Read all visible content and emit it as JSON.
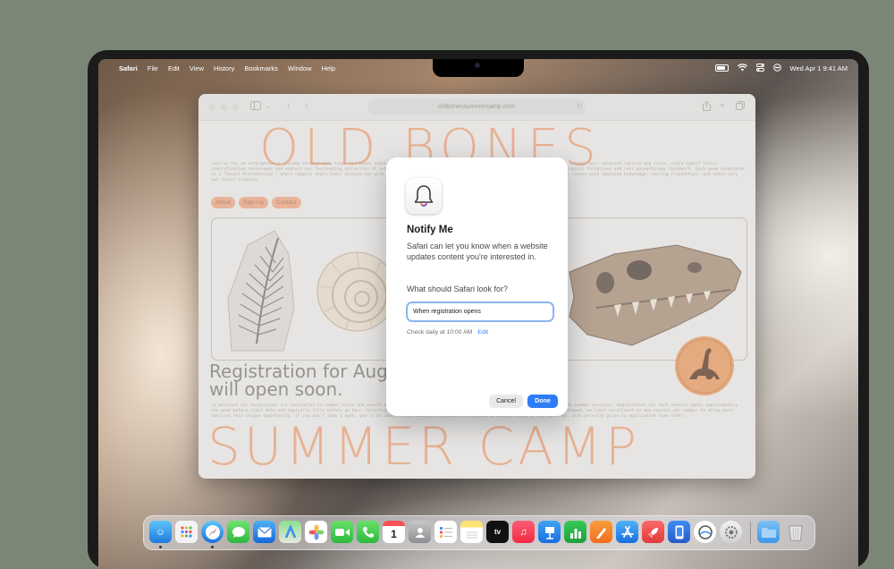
{
  "menubar": {
    "app": "Safari",
    "menus": [
      "File",
      "Edit",
      "View",
      "History",
      "Bookmarks",
      "Window",
      "Help"
    ],
    "datetime": "Wed Apr 1  9:41 AM"
  },
  "safari": {
    "url": "oldbonessummercamp.com"
  },
  "website": {
    "title_top": "OLD BONES",
    "title_bottom": "SUMMER CAMP",
    "intro": "Join us for an unforgettable journey through deep time! Old Bones Summer Camp offers an immersive and intellectually engaging hands-on Dinosaurs Campers will excavate replica dig sites, learn expert fossil identification techniques and explore our fascinating collection of authentic fossils and minerals. Daily activities include hikes to active geological formations and real paleontology fieldwork. Each week culminates in a \"Fossil Presentation,\" where campers share their discoveries with family and friends. Join us for a summer of exploration where every camper leaves with newfound knowledge, lasting friendships, and their very own fossil treasure.",
    "nav": [
      "About",
      "Sign Up",
      "Contact"
    ],
    "registration_heading_1": "Registration for Augu",
    "registration_heading_2": "will open soon.",
    "registration_body": "To maintain our exceptional 1:6 instructor-to-camper ratio and ensure a quality experience, each weekly session at just 24 campers. We offer three summer sessions. Registration for each session opens approximately one week before start date and typically fills within an hour. Securing your camper's spot requires a completed application and deposit. Due to demand, we limit enrollment to one session per camper to allow more families this unique opportunity. If you don't snag a spot, you'll be added to the waitlist and will be notified within 24 hours of any openings, with priority given by application time order."
  },
  "dialog": {
    "title": "Notify Me",
    "description": "Safari can let you know when a website updates content you're interested in.",
    "question": "What should Safari look for?",
    "input_value": "When registration opens",
    "schedule": "Check daily at 10:00 AM",
    "edit_label": "Edit",
    "cancel_label": "Cancel",
    "done_label": "Done"
  },
  "dock": {
    "calendar_day": "1",
    "tv_label": "tv"
  },
  "colors": {
    "accent_orange": "#e9a580",
    "system_blue": "#2e7cf6"
  }
}
